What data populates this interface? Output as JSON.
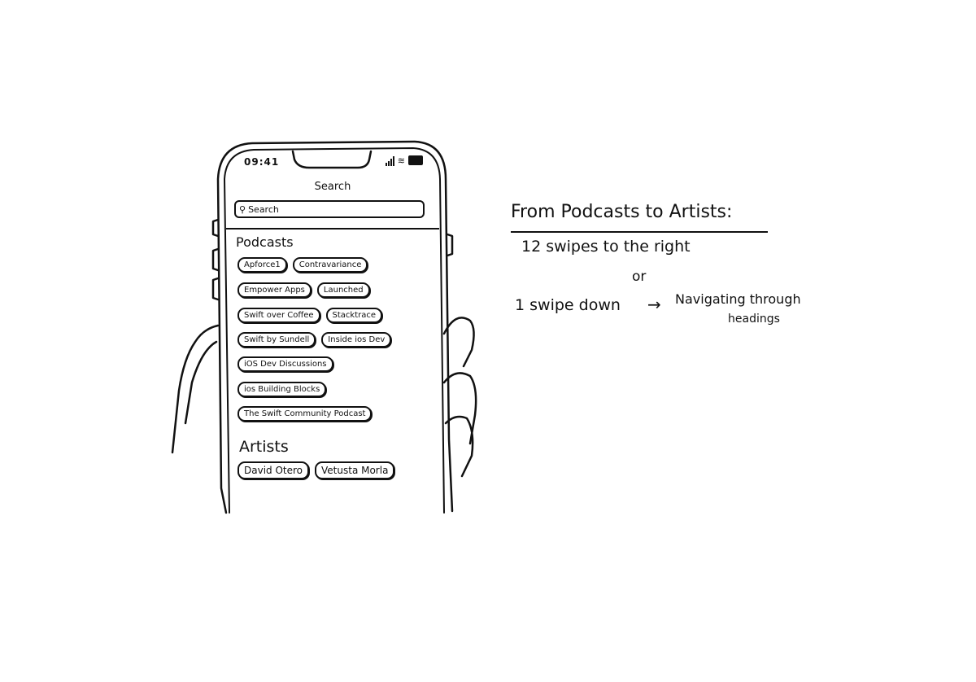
{
  "phone": {
    "status_time": "09:41",
    "nav_title": "Search",
    "search": {
      "placeholder": "Search"
    },
    "sections": [
      {
        "heading": "Podcasts",
        "rows": [
          [
            "Apforce1",
            "Contravariance"
          ],
          [
            "Empower Apps",
            "Launched"
          ],
          [
            "Swift over Coffee",
            "Stacktrace"
          ],
          [
            "Swift by Sundell",
            "Inside ios Dev"
          ],
          [
            "iOS Dev Discussions"
          ],
          [
            "ios Building Blocks"
          ],
          [
            "The Swift Community Podcast"
          ]
        ]
      },
      {
        "heading": "Artists",
        "rows": [
          [
            "David Otero",
            "Vetusta Morla"
          ]
        ]
      }
    ]
  },
  "annotation": {
    "title": "From Podcasts to Artists:",
    "line1": "12 swipes to the right",
    "or": "or",
    "line2": "1 swipe down",
    "arrow": "→",
    "nav_text_1": "Navigating through",
    "nav_text_2": "headings"
  }
}
